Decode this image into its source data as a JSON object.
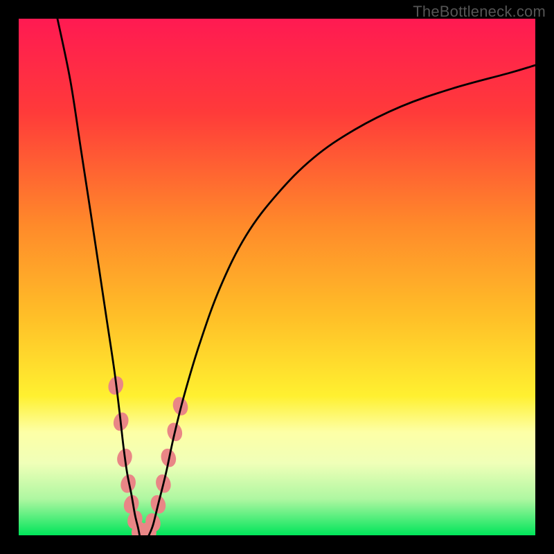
{
  "watermark": "TheBottleneck.com",
  "chart_data": {
    "type": "line",
    "title": "",
    "xlabel": "",
    "ylabel": "",
    "xlim": [
      0,
      100
    ],
    "ylim": [
      0,
      100
    ],
    "grid": false,
    "legend": false,
    "background_gradient_stops": [
      {
        "offset": 0.0,
        "color": "#ff1a52"
      },
      {
        "offset": 0.18,
        "color": "#ff3a3a"
      },
      {
        "offset": 0.4,
        "color": "#ff8a2a"
      },
      {
        "offset": 0.58,
        "color": "#ffc028"
      },
      {
        "offset": 0.73,
        "color": "#fff030"
      },
      {
        "offset": 0.8,
        "color": "#fdffa6"
      },
      {
        "offset": 0.86,
        "color": "#f0ffb8"
      },
      {
        "offset": 0.93,
        "color": "#aef7a1"
      },
      {
        "offset": 1.0,
        "color": "#00e55a"
      }
    ],
    "series": [
      {
        "name": "left-curve",
        "x": [
          7.5,
          10,
          12,
          14,
          15.5,
          17,
          18.5,
          19.5,
          20.3,
          21.0,
          21.8,
          22.5,
          23.1,
          23.4
        ],
        "y": [
          100,
          88,
          75,
          62,
          52,
          42,
          32,
          24,
          17,
          12,
          8,
          4,
          1.5,
          0
        ],
        "color": "#000000",
        "width": 2.8
      },
      {
        "name": "right-curve",
        "x": [
          25.2,
          26,
          27,
          28.5,
          30,
          32,
          35,
          39,
          44,
          50,
          57,
          65,
          74,
          84,
          95,
          100
        ],
        "y": [
          0,
          2,
          6,
          12,
          19,
          27,
          37,
          48,
          58,
          66,
          73,
          78.5,
          83,
          86.5,
          89.5,
          91
        ],
        "color": "#000000",
        "width": 2.8
      }
    ],
    "scatter": {
      "name": "highlighted-points",
      "color": "#e98686",
      "radius": 10,
      "points": [
        {
          "x": 18.8,
          "y": 29
        },
        {
          "x": 19.8,
          "y": 22
        },
        {
          "x": 20.5,
          "y": 15
        },
        {
          "x": 21.2,
          "y": 10
        },
        {
          "x": 21.8,
          "y": 6
        },
        {
          "x": 22.5,
          "y": 3
        },
        {
          "x": 23.3,
          "y": 0.8
        },
        {
          "x": 24.3,
          "y": 0.4
        },
        {
          "x": 25.2,
          "y": 0.8
        },
        {
          "x": 26.0,
          "y": 2.5
        },
        {
          "x": 27.0,
          "y": 6
        },
        {
          "x": 28.0,
          "y": 10
        },
        {
          "x": 29.0,
          "y": 15
        },
        {
          "x": 30.2,
          "y": 20
        },
        {
          "x": 31.3,
          "y": 25
        }
      ]
    }
  }
}
